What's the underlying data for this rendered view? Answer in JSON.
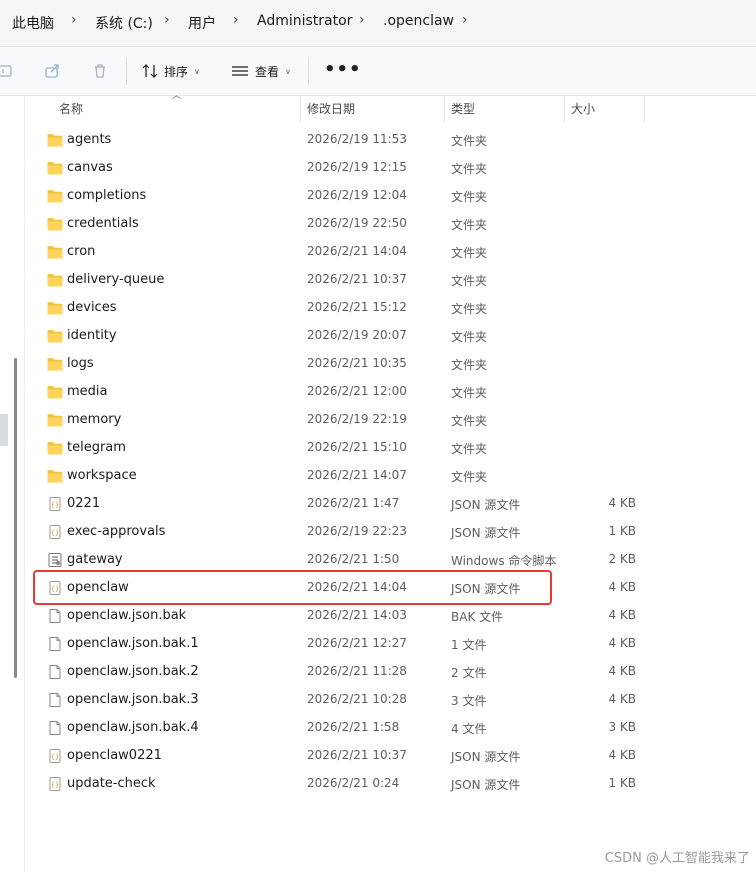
{
  "breadcrumb": [
    "此电脑",
    "系统 (C:)",
    "用户",
    "Administrator",
    ".openclaw"
  ],
  "toolbar": {
    "sort_label": "排序",
    "view_label": "查看",
    "more_label": "•••"
  },
  "columns": {
    "name": "名称",
    "date": "修改日期",
    "type": "类型",
    "size": "大小"
  },
  "files": [
    {
      "name": "agents",
      "date": "2026/2/19 11:53",
      "type": "文件夹",
      "size": "",
      "icon": "folder"
    },
    {
      "name": "canvas",
      "date": "2026/2/19 12:15",
      "type": "文件夹",
      "size": "",
      "icon": "folder"
    },
    {
      "name": "completions",
      "date": "2026/2/19 12:04",
      "type": "文件夹",
      "size": "",
      "icon": "folder"
    },
    {
      "name": "credentials",
      "date": "2026/2/19 22:50",
      "type": "文件夹",
      "size": "",
      "icon": "folder"
    },
    {
      "name": "cron",
      "date": "2026/2/21 14:04",
      "type": "文件夹",
      "size": "",
      "icon": "folder"
    },
    {
      "name": "delivery-queue",
      "date": "2026/2/21 10:37",
      "type": "文件夹",
      "size": "",
      "icon": "folder"
    },
    {
      "name": "devices",
      "date": "2026/2/21 15:12",
      "type": "文件夹",
      "size": "",
      "icon": "folder"
    },
    {
      "name": "identity",
      "date": "2026/2/19 20:07",
      "type": "文件夹",
      "size": "",
      "icon": "folder"
    },
    {
      "name": "logs",
      "date": "2026/2/21 10:35",
      "type": "文件夹",
      "size": "",
      "icon": "folder"
    },
    {
      "name": "media",
      "date": "2026/2/21 12:00",
      "type": "文件夹",
      "size": "",
      "icon": "folder"
    },
    {
      "name": "memory",
      "date": "2026/2/19 22:19",
      "type": "文件夹",
      "size": "",
      "icon": "folder"
    },
    {
      "name": "telegram",
      "date": "2026/2/21 15:10",
      "type": "文件夹",
      "size": "",
      "icon": "folder"
    },
    {
      "name": "workspace",
      "date": "2026/2/21 14:07",
      "type": "文件夹",
      "size": "",
      "icon": "folder"
    },
    {
      "name": "0221",
      "date": "2026/2/21 1:47",
      "type": "JSON 源文件",
      "size": "4 KB",
      "icon": "json"
    },
    {
      "name": "exec-approvals",
      "date": "2026/2/19 22:23",
      "type": "JSON 源文件",
      "size": "1 KB",
      "icon": "json"
    },
    {
      "name": "gateway",
      "date": "2026/2/21 1:50",
      "type": "Windows 命令脚本",
      "size": "2 KB",
      "icon": "script"
    },
    {
      "name": "openclaw",
      "date": "2026/2/21 14:04",
      "type": "JSON 源文件",
      "size": "4 KB",
      "icon": "json"
    },
    {
      "name": "openclaw.json.bak",
      "date": "2026/2/21 14:03",
      "type": "BAK 文件",
      "size": "4 KB",
      "icon": "file"
    },
    {
      "name": "openclaw.json.bak.1",
      "date": "2026/2/21 12:27",
      "type": "1 文件",
      "size": "4 KB",
      "icon": "file"
    },
    {
      "name": "openclaw.json.bak.2",
      "date": "2026/2/21 11:28",
      "type": "2 文件",
      "size": "4 KB",
      "icon": "file"
    },
    {
      "name": "openclaw.json.bak.3",
      "date": "2026/2/21 10:28",
      "type": "3 文件",
      "size": "4 KB",
      "icon": "file"
    },
    {
      "name": "openclaw.json.bak.4",
      "date": "2026/2/21 1:58",
      "type": "4 文件",
      "size": "3 KB",
      "icon": "file"
    },
    {
      "name": "openclaw0221",
      "date": "2026/2/21 10:37",
      "type": "JSON 源文件",
      "size": "4 KB",
      "icon": "json"
    },
    {
      "name": "update-check",
      "date": "2026/2/21 0:24",
      "type": "JSON 源文件",
      "size": "1 KB",
      "icon": "json"
    }
  ],
  "highlighted_file": "openclaw",
  "highlight_color": "#e83a34",
  "watermark": "CSDN @人工智能我来了"
}
